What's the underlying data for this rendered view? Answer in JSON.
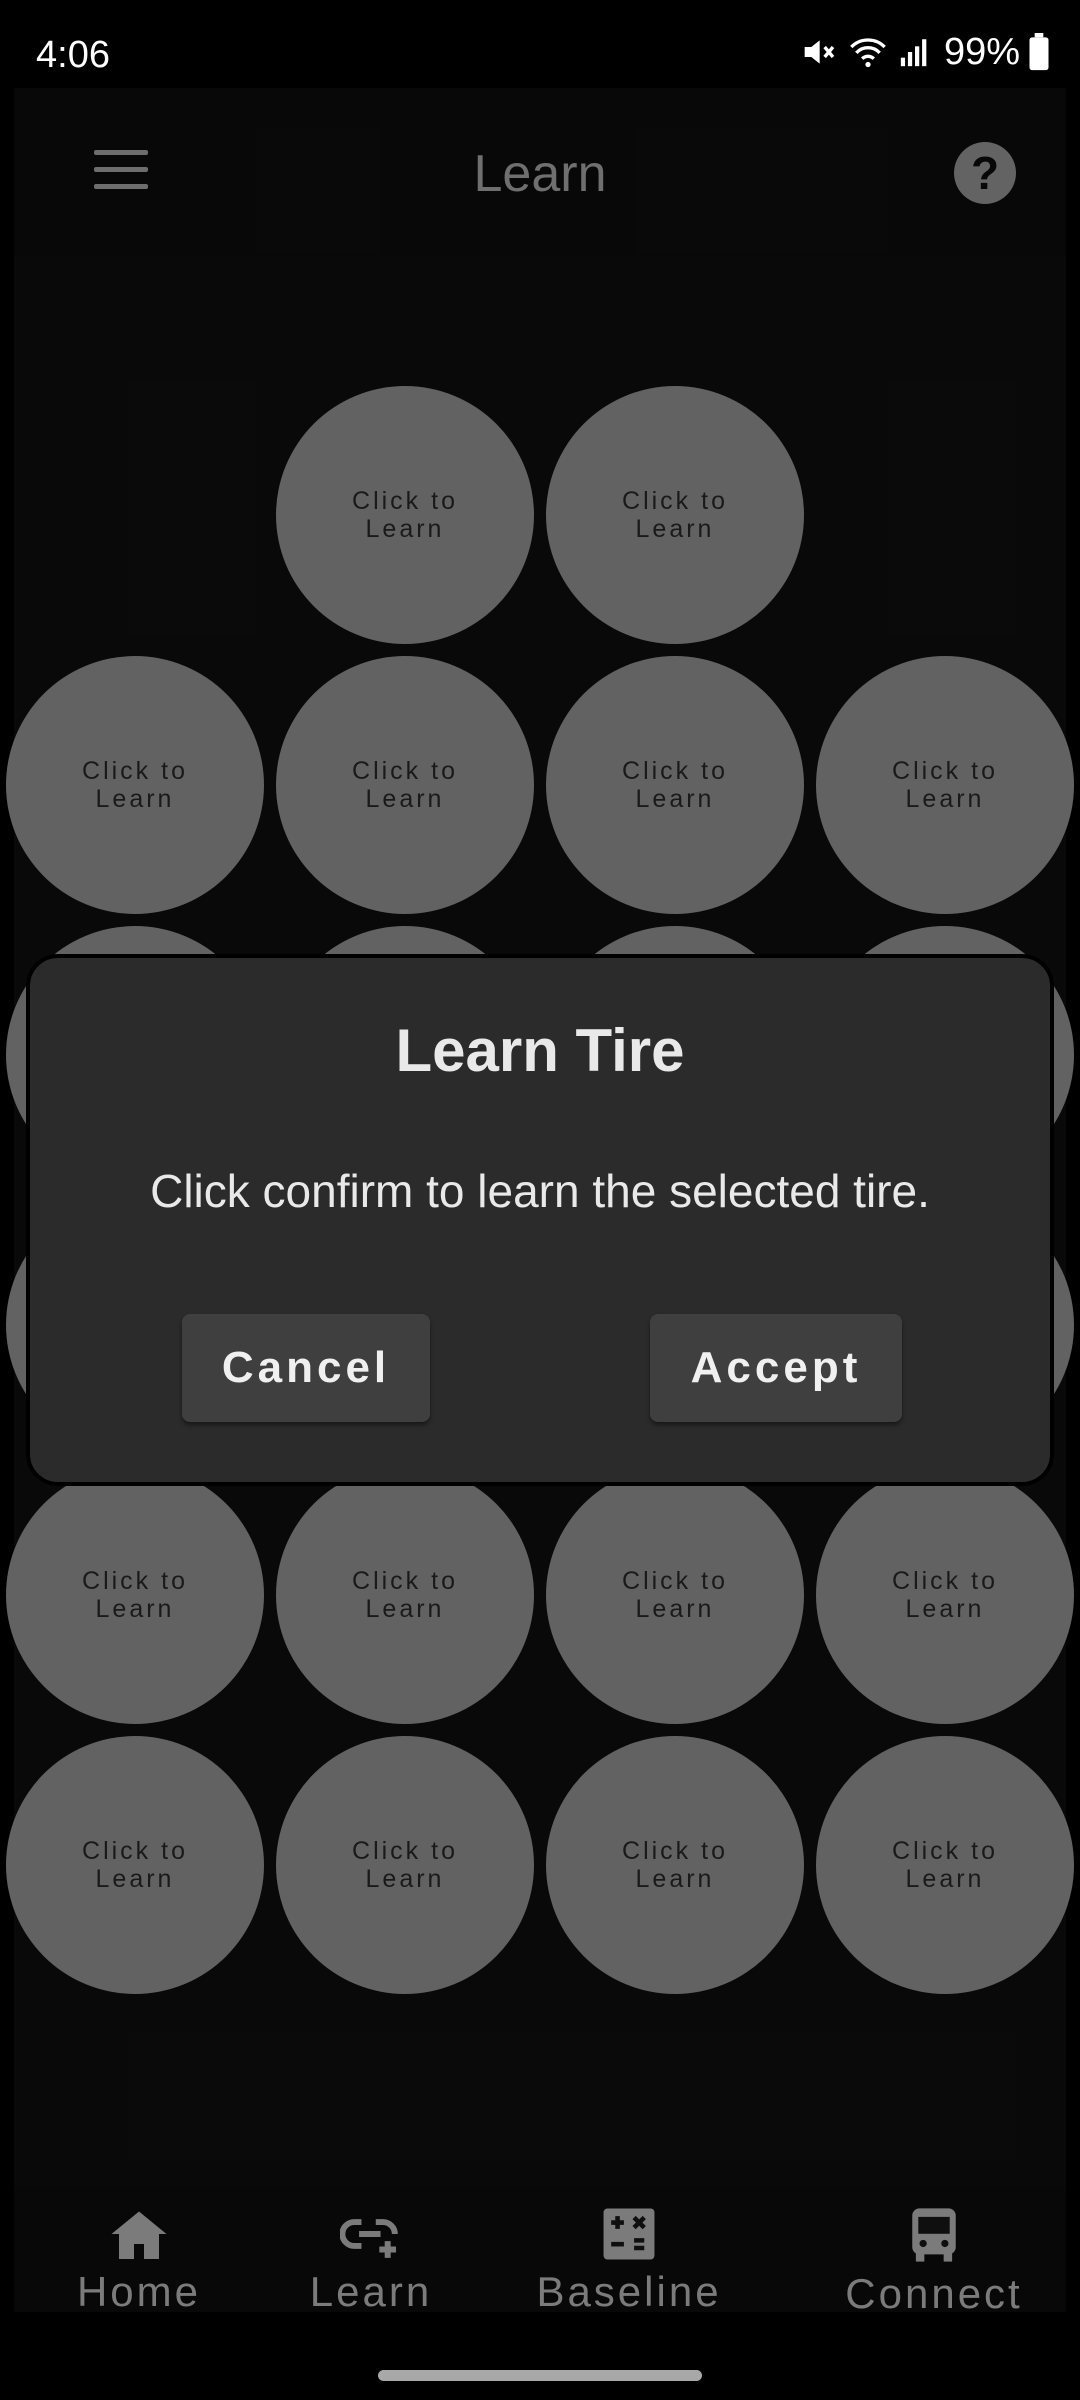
{
  "status_bar": {
    "time": "4:06",
    "battery": "99%"
  },
  "app_bar": {
    "title": "Learn"
  },
  "tires": {
    "label_line1": "Click to",
    "label_line2": "Learn"
  },
  "dialog": {
    "title": "Learn Tire",
    "message": "Click confirm to learn the selected tire.",
    "cancel_label": "Cancel",
    "accept_label": "Accept"
  },
  "bottom_nav": {
    "items": [
      {
        "label": "Home",
        "icon": "home-icon"
      },
      {
        "label": "Learn",
        "icon": "learn-icon"
      },
      {
        "label": "Baseline",
        "icon": "calculator-icon"
      },
      {
        "label": "Connect",
        "icon": "bus-icon"
      }
    ]
  },
  "colors": {
    "background": "#000000",
    "tire": "#6e6e6e",
    "dialog": "#2b2b2b",
    "button": "#3f3f3f"
  }
}
